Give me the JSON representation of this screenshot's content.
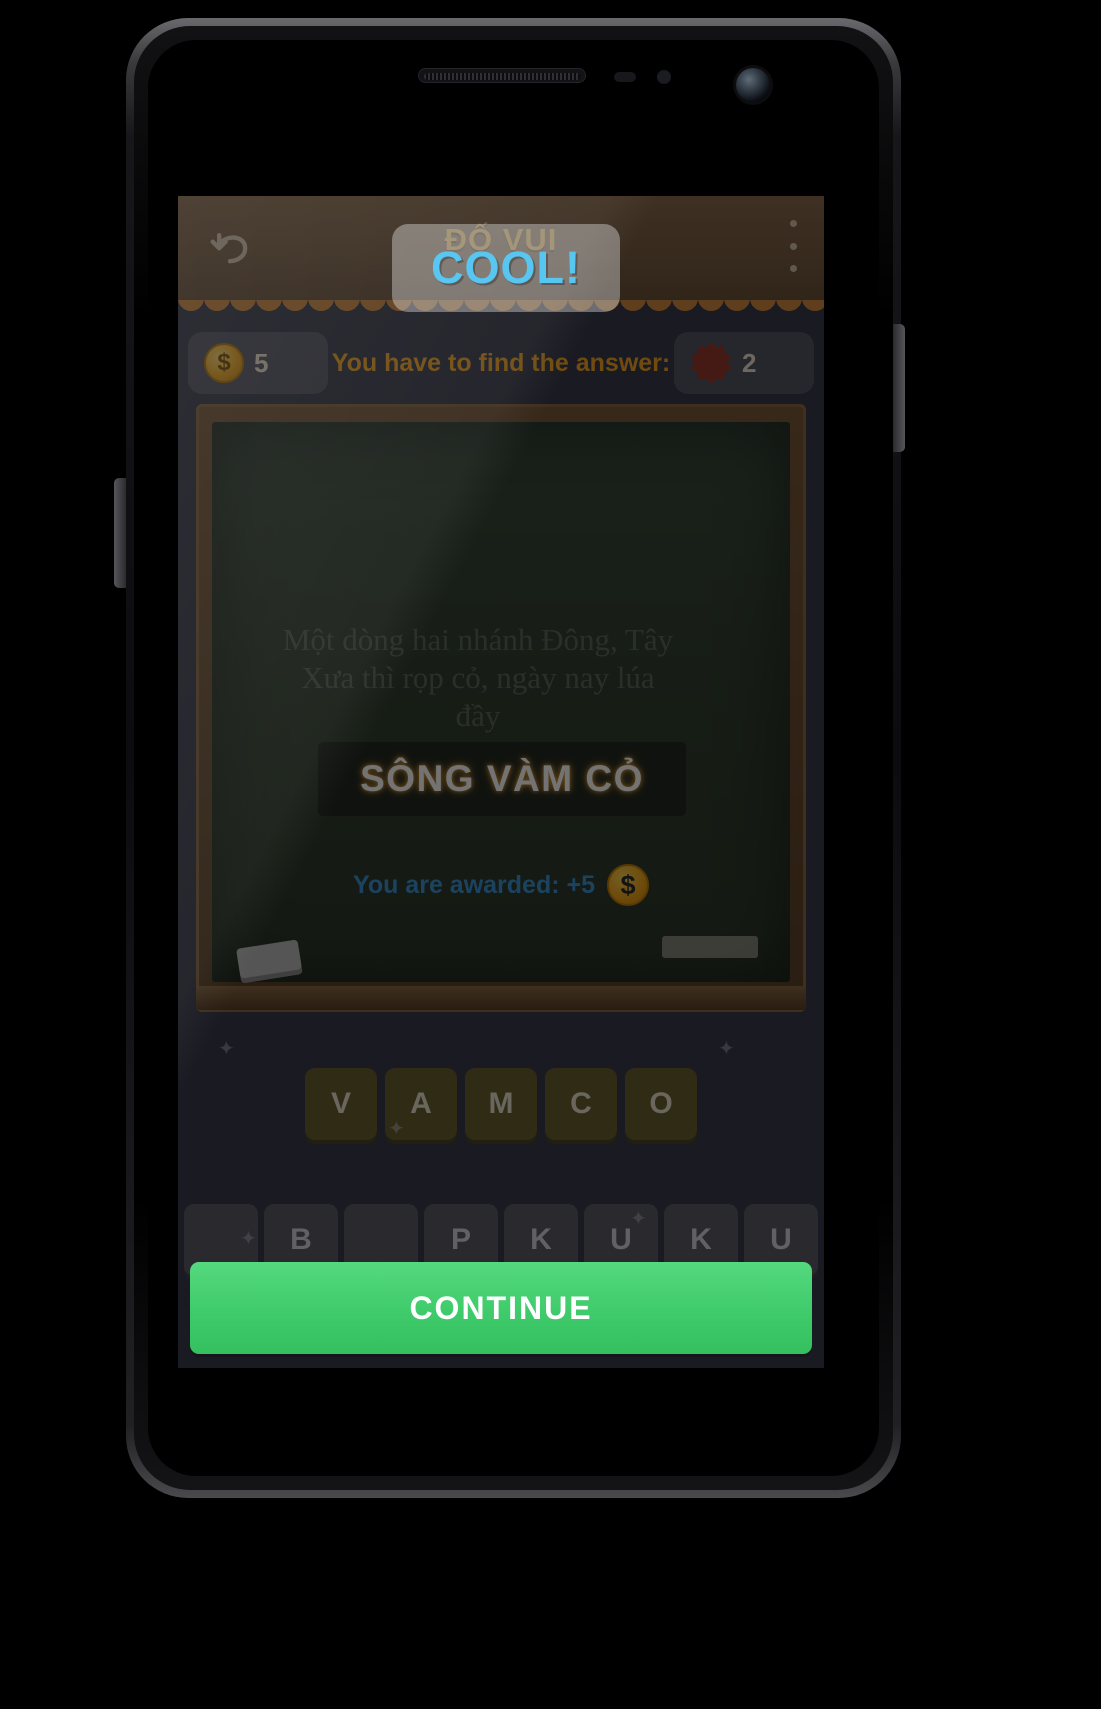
{
  "app": {
    "header_title": "ĐỐ VUI",
    "back_icon": "back-arrow-icon",
    "menu_icon": "overflow-menu-icon"
  },
  "status": {
    "coin_icon": "coin-icon",
    "coin_symbol": "$",
    "coin_count": "5",
    "badge_icon": "rosette-badge-icon",
    "badge_count": "2",
    "prompt": "You have to find the answer:"
  },
  "board": {
    "riddle_line1": "Một dòng hai nhánh Đông, Tây",
    "riddle_line2": "Xưa thì rọp cỏ, ngày nay lúa",
    "riddle_line3": "đầy",
    "answer": "SÔNG VÀM CỎ",
    "award_label": "You are awarded: +5",
    "award_coin_symbol": "$"
  },
  "slots": [
    {
      "letter": "V"
    },
    {
      "letter": "A"
    },
    {
      "letter": "M"
    },
    {
      "letter": "C"
    },
    {
      "letter": "O"
    }
  ],
  "keys": [
    {
      "letter": ""
    },
    {
      "letter": "B"
    },
    {
      "letter": ""
    },
    {
      "letter": "P"
    },
    {
      "letter": "K"
    },
    {
      "letter": "U"
    },
    {
      "letter": "K"
    },
    {
      "letter": "U"
    }
  ],
  "dialog": {
    "title": "COOL!",
    "continue_label": "CONTINUE"
  },
  "colors": {
    "accent_cyan": "#4ec3f0",
    "accent_orange": "#f5a623",
    "accent_green": "#3fcb6b",
    "coin_gold": "#f0a81e",
    "board_green": "#32402f",
    "wood_brown": "#7a5e43"
  }
}
